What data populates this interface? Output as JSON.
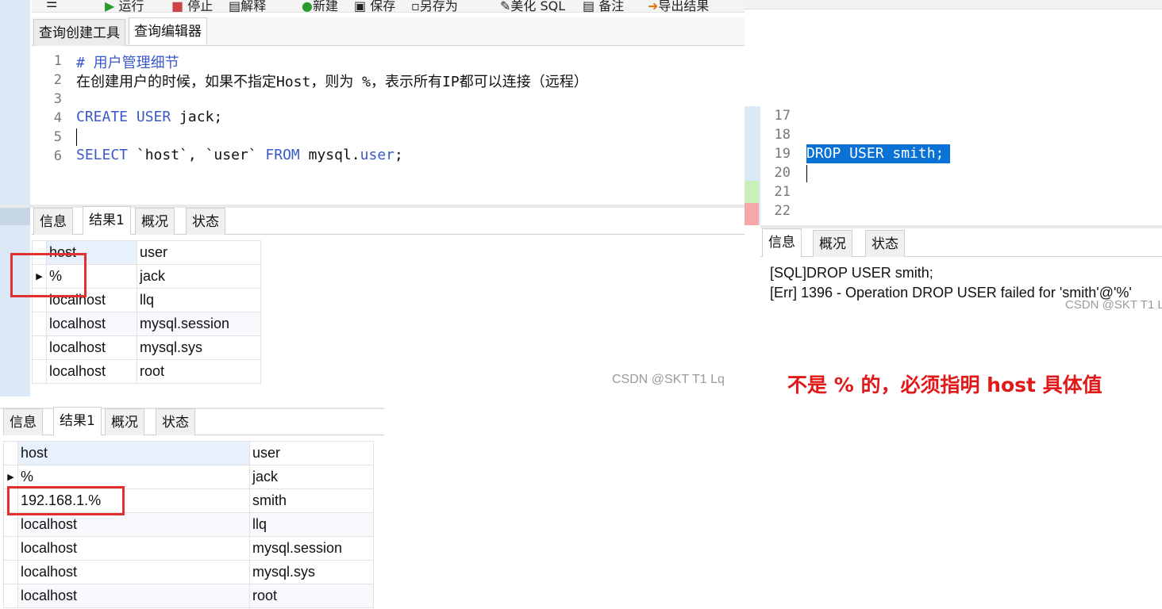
{
  "toolbar": {
    "menu_icon": "menu-icon",
    "run_label": "运行",
    "stop_label": "停止",
    "explain_label": "解释",
    "new_label": "新建",
    "save_label": "保存",
    "save_as_label": "另存为",
    "beautify_label": "美化 SQL",
    "comment_label": "备注",
    "export_label": "导出结果"
  },
  "editor_tabs": [
    "查询创建工具",
    "查询编辑器"
  ],
  "editor": {
    "lines": [
      {
        "num": "1",
        "text": "# 用户管理细节"
      },
      {
        "num": "2",
        "text": "在创建用户的时候，如果不指定Host，则为 %，表示所有IP都可以连接（远程）"
      },
      {
        "num": "3",
        "text": ""
      },
      {
        "num": "4",
        "kw1": "CREATE USER",
        "rest": " jack;"
      },
      {
        "num": "5",
        "text": ""
      },
      {
        "num": "6",
        "kw1": "SELECT",
        "mid": " `host`, `user` ",
        "kw2": "FROM",
        "obj": " mysql.",
        "kw3": "user",
        "end": ";"
      }
    ]
  },
  "result_tabs": [
    "信息",
    "结果1",
    "概况",
    "状态"
  ],
  "result1": {
    "columns": [
      "host",
      "user"
    ],
    "rows": [
      [
        "%",
        "jack"
      ],
      [
        "localhost",
        "llq"
      ],
      [
        "localhost",
        "mysql.session"
      ],
      [
        "localhost",
        "mysql.sys"
      ],
      [
        "localhost",
        "root"
      ]
    ]
  },
  "result2": {
    "columns": [
      "host",
      "user"
    ],
    "rows": [
      [
        "%",
        "jack"
      ],
      [
        "192.168.1.%",
        "smith"
      ],
      [
        "localhost",
        "llq"
      ],
      [
        "localhost",
        "mysql.session"
      ],
      [
        "localhost",
        "mysql.sys"
      ],
      [
        "localhost",
        "root"
      ]
    ]
  },
  "right_editor": {
    "lines": [
      "17",
      "18",
      "19",
      "20",
      "21",
      "22"
    ],
    "selected_code": "DROP USER smith;"
  },
  "right_tabs": [
    "信息",
    "概况",
    "状态"
  ],
  "messages": [
    "[SQL]DROP USER smith;",
    "[Err] 1396 - Operation DROP USER failed for 'smith'@'%'"
  ],
  "watermark": "CSDN @SKT T1 Lq",
  "annotation": "不是 % 的，必须指明 host 具体值",
  "colors": {
    "highlight_box": "#e23030",
    "selection": "#0a72d6",
    "annotation": "#e01818",
    "keyword": "#3a58c8"
  }
}
